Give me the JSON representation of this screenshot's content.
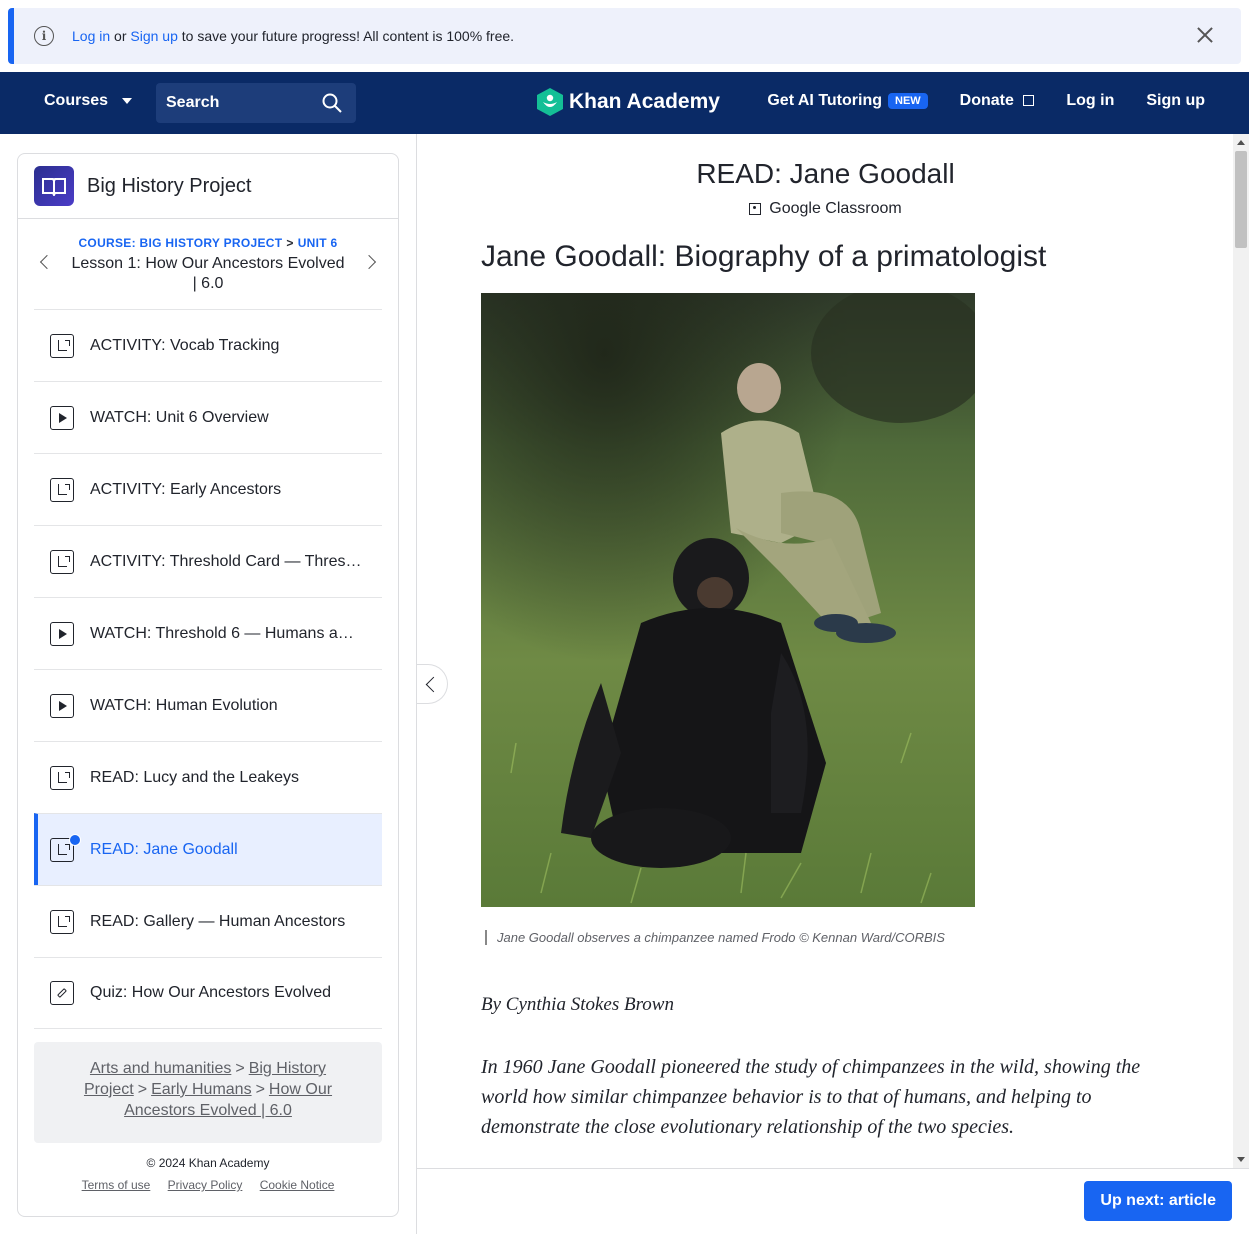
{
  "banner": {
    "login_link": "Log in",
    "or": "or",
    "signup_link": "Sign up",
    "message": "to save your future progress! All content is 100% free."
  },
  "nav": {
    "courses": "Courses",
    "search_label": "Search",
    "logo": "Khan Academy",
    "ai_tutoring": "Get AI Tutoring",
    "new_badge": "NEW",
    "donate": "Donate",
    "login": "Log in",
    "signup": "Sign up"
  },
  "sidebar": {
    "course_title": "Big History Project",
    "crumb_course": "COURSE: BIG HISTORY PROJECT",
    "crumb_sep": ">",
    "crumb_unit": "UNIT 6",
    "lesson_title": "Lesson 1: How Our Ancestors Evolved | 6.0",
    "items": [
      {
        "label": "ACTIVITY: Vocab Tracking",
        "icon": "article-icon"
      },
      {
        "label": "WATCH: Unit 6 Overview",
        "icon": "video-icon"
      },
      {
        "label": "ACTIVITY: Early Ancestors",
        "icon": "article-icon"
      },
      {
        "label": "ACTIVITY: Threshold Card — Thres…",
        "icon": "article-icon"
      },
      {
        "label": "WATCH: Threshold 6 — Humans a…",
        "icon": "video-icon"
      },
      {
        "label": "WATCH: Human Evolution",
        "icon": "video-icon"
      },
      {
        "label": "READ: Lucy and the Leakeys",
        "icon": "article-icon"
      },
      {
        "label": "READ: Jane Goodall",
        "icon": "article-icon",
        "active": true
      },
      {
        "label": "READ: Gallery — Human Ancestors",
        "icon": "article-icon"
      },
      {
        "label": "Quiz: How Our Ancestors Evolved",
        "icon": "quiz-icon"
      }
    ],
    "breadcrumbs": {
      "arts": "Arts and humanities",
      "bhp": "Big History Project",
      "early": "Early Humans",
      "lesson": "How Our Ancestors Evolved | 6.0",
      "sep": ">"
    },
    "copyright": "© 2024 Khan Academy",
    "terms": "Terms of use",
    "privacy": "Privacy Policy",
    "cookie": "Cookie Notice"
  },
  "content": {
    "page_title": "READ: Jane Goodall",
    "google_classroom": "Google Classroom",
    "heading": "Jane Goodall: Biography of a primatologist",
    "caption": "Jane Goodall observes a chimpanzee named Frodo © Kennan Ward/CORBIS",
    "byline": "By Cynthia Stokes Brown",
    "intro": "In 1960 Jane Goodall pioneered the study of chimpanzees in the wild, showing the world how similar chimpanzee behavior is to that of humans, and helping to demonstrate the close evolutionary relationship of the two species."
  },
  "footer": {
    "up_next": "Up next: article"
  },
  "colors": {
    "brand_blue": "#1865f2",
    "nav_bg": "#0a2a66",
    "khan_green": "#14bf96"
  }
}
